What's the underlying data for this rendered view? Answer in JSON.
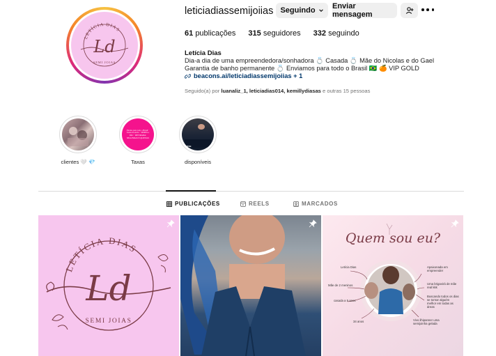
{
  "profile": {
    "username": "leticiadiassemijoiias",
    "follow_label": "Seguindo",
    "message_label": "Enviar mensagem",
    "posts_count": "61",
    "posts_label": "publicações",
    "followers_count": "315",
    "followers_label": "seguidores",
    "following_count": "332",
    "following_label": "seguindo",
    "full_name": "Letícia Dias",
    "bio_line1": "Dia-a dia de uma empreendedora/sonhadora 💍 Casada 💍 Mãe do Nicolas e do Gael",
    "bio_line2": "Garantia de banho permanente 💍 Enviamos para todo o Brasil 🇧🇷 🍊 VIP GOLD",
    "link": "beacons.ai/leticiadiassemijoiias + 1",
    "followed_prefix": "Seguido(a) por",
    "followed_names": "luanaliz_1, leticiadias014, kemillydiasas",
    "followed_suffix": "e outras 15 pessoas"
  },
  "avatar_logo": {
    "top_text": "LETÍCIA DIAS",
    "monogram": "Ld",
    "bottom_text": "SEMI JOIAS"
  },
  "highlights": [
    {
      "label": "clientes 🤍 💎"
    },
    {
      "label": "Taxas",
      "thumb_text": "Envios para todo o Brasil · Taxas de envio · SEDEX e PAC · RETIRADA: SEGUNDAS E QUINTAS"
    },
    {
      "label": "disponíveis",
      "thumb_text": "PRÉSE"
    }
  ],
  "tabs": [
    {
      "label": "PUBLICAÇÕES"
    },
    {
      "label": "REELS"
    },
    {
      "label": "MARCADOS"
    }
  ],
  "posts": {
    "logo": {
      "top_text": "LETÍCIA DIAS",
      "monogram": "Ld",
      "bottom_text": "SEMI JOIAS"
    },
    "about": {
      "title": "Quem sou eu?",
      "note_1": "Letícia Dias",
      "note_2": "Mãe de 2 meninos",
      "note_3": "casada a 5 anos",
      "note_4": "34 anos",
      "note_5": "Apaixonada em empreender",
      "note_6": "Uma brigavirá de mãe real kkk",
      "note_7": "Buscando todos os dias se tornar alguém melhor em todas as áreas",
      "note_8": "Vivo ilhipanner uma semijoinha gelada"
    }
  },
  "colors": {
    "accent_blue": "#00376b",
    "logo_pink": "#f7c6ee",
    "logo_brown": "#7a3b46",
    "taxas_pink": "#f5138d"
  }
}
